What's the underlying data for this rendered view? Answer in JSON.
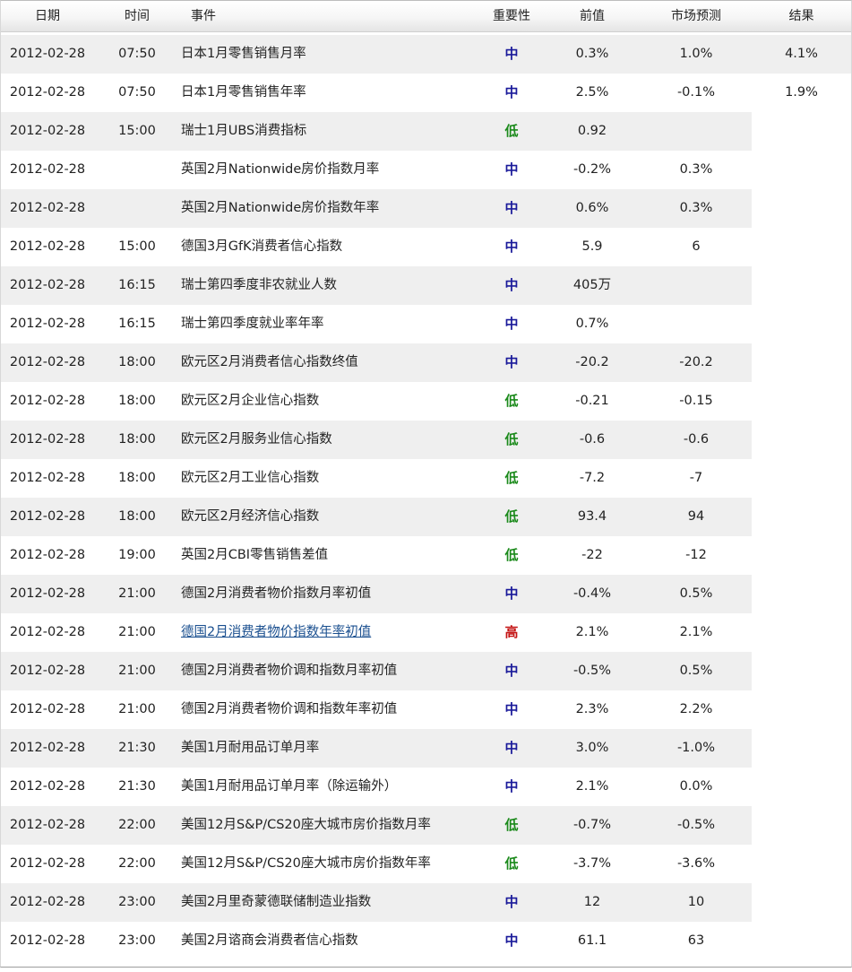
{
  "headers": {
    "date": "日期",
    "time": "时间",
    "event": "事件",
    "importance": "重要性",
    "previous": "前值",
    "forecast": "市场预测",
    "result": "结果"
  },
  "importance_colors": {
    "中": "#1a1a9a",
    "低": "#1b8a1b",
    "高": "#c41414"
  },
  "rows": [
    {
      "date": "2012-02-28",
      "time": "07:50",
      "event": "日本1月零售销售月率",
      "importance": "中",
      "previous": "0.3%",
      "forecast": "1.0%",
      "result": "4.1%"
    },
    {
      "date": "2012-02-28",
      "time": "07:50",
      "event": "日本1月零售销售年率",
      "importance": "中",
      "previous": "2.5%",
      "forecast": "-0.1%",
      "result": "1.9%"
    },
    {
      "date": "2012-02-28",
      "time": "15:00",
      "event": "瑞士1月UBS消费指标",
      "importance": "低",
      "previous": "0.92",
      "forecast": "",
      "result": ""
    },
    {
      "date": "2012-02-28",
      "time": "",
      "event": "英国2月Nationwide房价指数月率",
      "importance": "中",
      "previous": "-0.2%",
      "forecast": "0.3%",
      "result": ""
    },
    {
      "date": "2012-02-28",
      "time": "",
      "event": "英国2月Nationwide房价指数年率",
      "importance": "中",
      "previous": "0.6%",
      "forecast": "0.3%",
      "result": ""
    },
    {
      "date": "2012-02-28",
      "time": "15:00",
      "event": "德国3月GfK消费者信心指数",
      "importance": "中",
      "previous": "5.9",
      "forecast": "6",
      "result": ""
    },
    {
      "date": "2012-02-28",
      "time": "16:15",
      "event": "瑞士第四季度非农就业人数",
      "importance": "中",
      "previous": "405万",
      "forecast": "",
      "result": ""
    },
    {
      "date": "2012-02-28",
      "time": "16:15",
      "event": "瑞士第四季度就业率年率",
      "importance": "中",
      "previous": "0.7%",
      "forecast": "",
      "result": ""
    },
    {
      "date": "2012-02-28",
      "time": "18:00",
      "event": "欧元区2月消费者信心指数终值",
      "importance": "中",
      "previous": "-20.2",
      "forecast": "-20.2",
      "result": ""
    },
    {
      "date": "2012-02-28",
      "time": "18:00",
      "event": "欧元区2月企业信心指数",
      "importance": "低",
      "previous": "-0.21",
      "forecast": "-0.15",
      "result": ""
    },
    {
      "date": "2012-02-28",
      "time": "18:00",
      "event": "欧元区2月服务业信心指数",
      "importance": "低",
      "previous": "-0.6",
      "forecast": "-0.6",
      "result": ""
    },
    {
      "date": "2012-02-28",
      "time": "18:00",
      "event": "欧元区2月工业信心指数",
      "importance": "低",
      "previous": "-7.2",
      "forecast": "-7",
      "result": ""
    },
    {
      "date": "2012-02-28",
      "time": "18:00",
      "event": "欧元区2月经济信心指数",
      "importance": "低",
      "previous": "93.4",
      "forecast": "94",
      "result": ""
    },
    {
      "date": "2012-02-28",
      "time": "19:00",
      "event": "英国2月CBI零售销售差值",
      "importance": "低",
      "previous": "-22",
      "forecast": "-12",
      "result": ""
    },
    {
      "date": "2012-02-28",
      "time": "21:00",
      "event": "德国2月消费者物价指数月率初值",
      "importance": "中",
      "previous": "-0.4%",
      "forecast": "0.5%",
      "result": ""
    },
    {
      "date": "2012-02-28",
      "time": "21:00",
      "event": "德国2月消费者物价指数年率初值",
      "importance": "高",
      "previous": "2.1%",
      "forecast": "2.1%",
      "result": "",
      "link": true
    },
    {
      "date": "2012-02-28",
      "time": "21:00",
      "event": "德国2月消费者物价调和指数月率初值",
      "importance": "中",
      "previous": "-0.5%",
      "forecast": "0.5%",
      "result": ""
    },
    {
      "date": "2012-02-28",
      "time": "21:00",
      "event": "德国2月消费者物价调和指数年率初值",
      "importance": "中",
      "previous": "2.3%",
      "forecast": "2.2%",
      "result": ""
    },
    {
      "date": "2012-02-28",
      "time": "21:30",
      "event": "美国1月耐用品订单月率",
      "importance": "中",
      "previous": "3.0%",
      "forecast": "-1.0%",
      "result": ""
    },
    {
      "date": "2012-02-28",
      "time": "21:30",
      "event": "美国1月耐用品订单月率（除运输外）",
      "importance": "中",
      "previous": "2.1%",
      "forecast": "0.0%",
      "result": ""
    },
    {
      "date": "2012-02-28",
      "time": "22:00",
      "event": "美国12月S&P/CS20座大城市房价指数月率",
      "importance": "低",
      "previous": "-0.7%",
      "forecast": "-0.5%",
      "result": ""
    },
    {
      "date": "2012-02-28",
      "time": "22:00",
      "event": "美国12月S&P/CS20座大城市房价指数年率",
      "importance": "低",
      "previous": "-3.7%",
      "forecast": "-3.6%",
      "result": ""
    },
    {
      "date": "2012-02-28",
      "time": "23:00",
      "event": "美国2月里奇蒙德联储制造业指数",
      "importance": "中",
      "previous": "12",
      "forecast": "10",
      "result": ""
    },
    {
      "date": "2012-02-28",
      "time": "23:00",
      "event": "美国2月谘商会消费者信心指数",
      "importance": "中",
      "previous": "61.1",
      "forecast": "63",
      "result": ""
    }
  ]
}
